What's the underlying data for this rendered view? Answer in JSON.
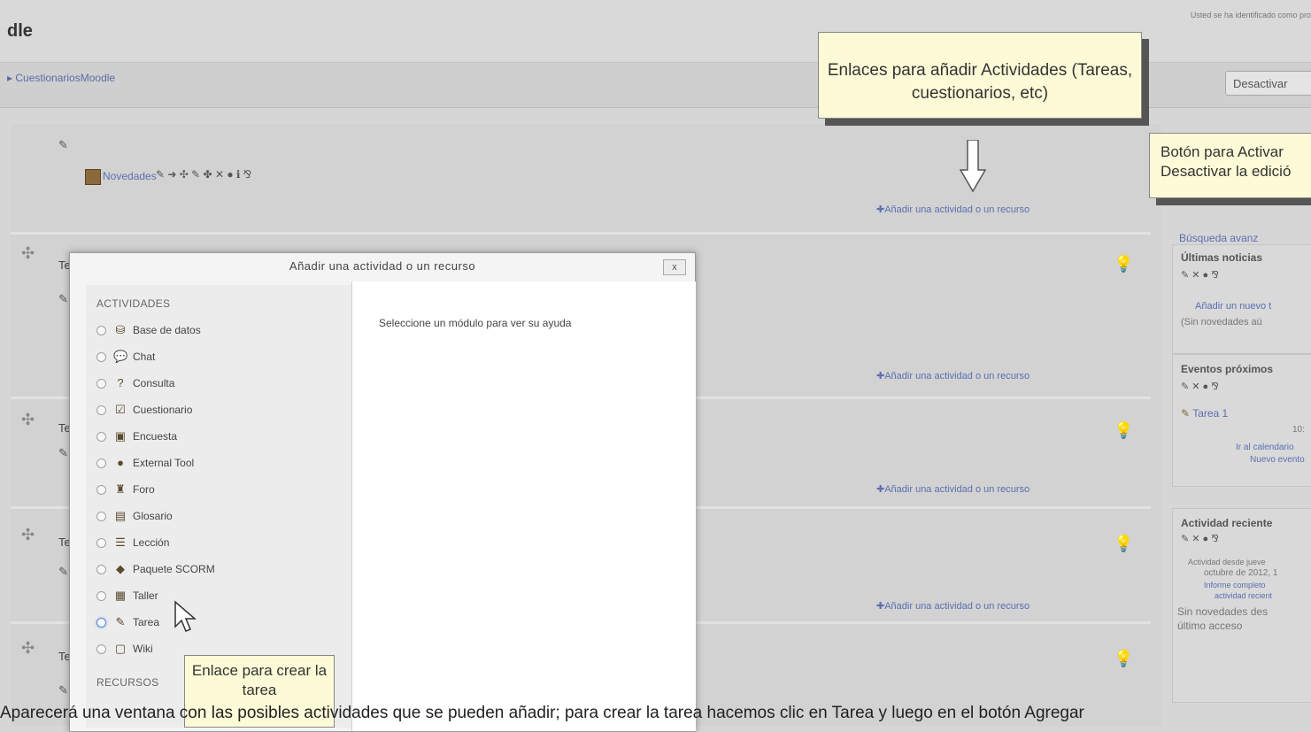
{
  "header": {
    "brand": "dle",
    "login_info": "Usted se ha identificado como pro"
  },
  "breadcrumb": {
    "item": "CuestionariosMoodle"
  },
  "toolbar": {
    "edit_button": "Desactivar"
  },
  "course": {
    "section0_news": "Novedades",
    "section0_icons": "✎ ➜ ✣ ✎ ✤ ✕ ● ℹ ⅋",
    "add_link": "✚Añadir una actividad o un recurso",
    "topic_fragment": "Te"
  },
  "callouts": {
    "top": "Enlaces para añadir Actividades (Tareas, cuestionarios, etc)",
    "edit": "Botón para Activar Desactivar la edició",
    "task": "Enlace para crear la tarea"
  },
  "dialog": {
    "title": "Añadir una actividad o un recurso",
    "close": "x",
    "help_text": "Seleccione un módulo para ver su ayuda",
    "activities_header": "ACTIVIDADES",
    "resources_header": "RECURSOS",
    "options": [
      {
        "label": "Base de datos",
        "icon": "database-icon"
      },
      {
        "label": "Chat",
        "icon": "chat-icon"
      },
      {
        "label": "Consulta",
        "icon": "question-icon"
      },
      {
        "label": "Cuestionario",
        "icon": "quiz-icon"
      },
      {
        "label": "Encuesta",
        "icon": "survey-icon"
      },
      {
        "label": "External Tool",
        "icon": "external-tool-icon"
      },
      {
        "label": "Foro",
        "icon": "forum-icon"
      },
      {
        "label": "Glosario",
        "icon": "glossary-icon"
      },
      {
        "label": "Lección",
        "icon": "lesson-icon"
      },
      {
        "label": "Paquete SCORM",
        "icon": "scorm-icon"
      },
      {
        "label": "Taller",
        "icon": "workshop-icon"
      },
      {
        "label": "Tarea",
        "icon": "assignment-icon"
      },
      {
        "label": "Wiki",
        "icon": "wiki-icon"
      }
    ]
  },
  "sidebar": {
    "search_link": "Búsqueda avanz",
    "news_title": "Últimas noticias",
    "news_add": "Añadir un nuevo t",
    "news_none": "(Sin novedades aú",
    "events_title": "Eventos próximos",
    "event_item": "Tarea 1",
    "event_time": "10:",
    "calendar_link": "Ir al calendario",
    "new_event": "Nuevo evento",
    "recent_title": "Actividad reciente",
    "recent_since_1": "Actividad desde jueve",
    "recent_since_2": "octubre de 2012, 1",
    "recent_report_1": "Informe completo",
    "recent_report_2": "actividad recient",
    "recent_none_1": "Sin novedades des",
    "recent_none_2": "último acceso",
    "block_icons": "✎ ✕ ● ⅋"
  },
  "footer": {
    "overlapped_text": "Aparecerá una ventana con las posibles actividades que se pueden añadir; para crear la tarea hacemos clic en Tarea y luego en el botón Agregar"
  }
}
